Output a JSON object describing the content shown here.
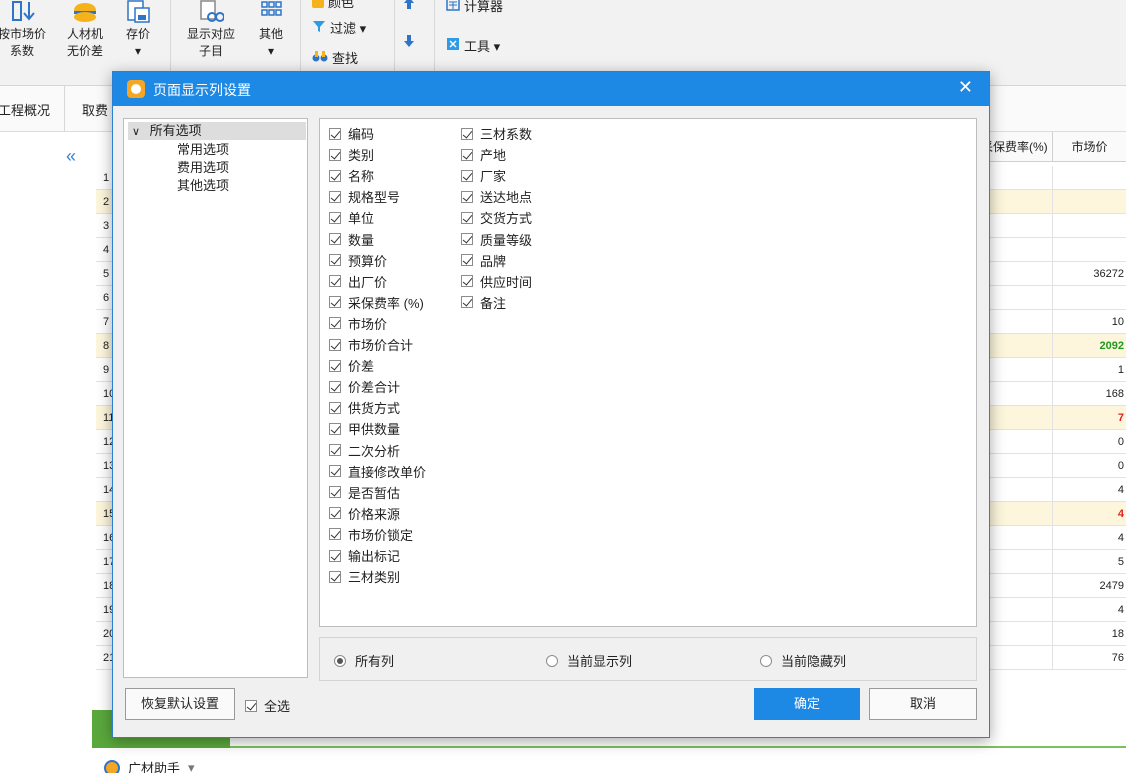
{
  "ribbon": {
    "btn_market_coef": {
      "line1": "按市场价",
      "line2": "系数"
    },
    "btn_no_diff": {
      "line1": "人材机",
      "line2": "无价差"
    },
    "btn_save_price": {
      "line1": "存价",
      "line2": "▾"
    },
    "btn_show_sub": {
      "line1": "显示对应",
      "line2": "子目"
    },
    "btn_other": {
      "line1": "其他",
      "line2": "▾"
    },
    "small_color": "颜色",
    "small_filter": "过滤 ▾",
    "small_find": "查找",
    "small_calc": "计算器",
    "small_tools": "工具 ▾"
  },
  "tabs": [
    "工程概况",
    "取费"
  ],
  "grid": {
    "header_rate": "采保费率(%)",
    "header_market": "市场价",
    "rows": [
      {
        "n": "1",
        "v": "",
        "hl": false
      },
      {
        "n": "2",
        "v": "",
        "hl": true
      },
      {
        "n": "3",
        "v": "",
        "hl": false
      },
      {
        "n": "4",
        "v": "",
        "hl": false
      },
      {
        "n": "5",
        "v": "36272",
        "hl": false
      },
      {
        "n": "6",
        "v": "",
        "hl": false
      },
      {
        "n": "7",
        "v": "10",
        "hl": false
      },
      {
        "n": "8",
        "v": "2092",
        "hl": true,
        "color": "#1e9a1e"
      },
      {
        "n": "9",
        "v": "1",
        "hl": false
      },
      {
        "n": "10",
        "v": "168",
        "hl": false
      },
      {
        "n": "11",
        "v": "7",
        "hl": true,
        "color": "#e02020"
      },
      {
        "n": "12",
        "v": "0",
        "hl": false
      },
      {
        "n": "13",
        "v": "0",
        "hl": false
      },
      {
        "n": "14",
        "v": "4",
        "hl": false
      },
      {
        "n": "15",
        "v": "4",
        "hl": true,
        "color": "#e02020"
      },
      {
        "n": "16",
        "v": "4",
        "hl": false
      },
      {
        "n": "17",
        "v": "5",
        "hl": false
      },
      {
        "n": "18",
        "v": "2479",
        "hl": false
      },
      {
        "n": "19",
        "v": "4",
        "hl": false
      },
      {
        "n": "20",
        "v": "18",
        "hl": false
      },
      {
        "n": "21",
        "v": "76",
        "hl": false
      }
    ]
  },
  "assistant": {
    "label": "广材助手",
    "arrow": "▾"
  },
  "dialog": {
    "title": "页面显示列设置",
    "close": "✕",
    "tree": {
      "root": "所有选项",
      "children": [
        "常用选项",
        "费用选项",
        "其他选项"
      ]
    },
    "columns_left": [
      "编码",
      "类别",
      "名称",
      "规格型号",
      "单位",
      "数量",
      "预算价",
      "出厂价",
      "采保费率 (%)",
      "市场价",
      "市场价合计",
      "价差",
      "价差合计",
      "供货方式",
      "甲供数量",
      "二次分析",
      "直接修改单价",
      "是否暂估",
      "价格来源",
      "市场价锁定",
      "输出标记",
      "三材类别"
    ],
    "columns_right": [
      "三材系数",
      "产地",
      "厂家",
      "送达地点",
      "交货方式",
      "质量等级",
      "品牌",
      "供应时间",
      "备注"
    ],
    "radios": [
      "所有列",
      "当前显示列",
      "当前隐藏列"
    ],
    "restore_btn": "恢复默认设置",
    "select_all": "全选",
    "ok_btn": "确定",
    "cancel_btn": "取消"
  },
  "colors": {
    "title_bar": "#1e88e5",
    "primary_button": "#1e88e5",
    "green_value": "#1e9a1e",
    "red_value": "#e02020"
  }
}
